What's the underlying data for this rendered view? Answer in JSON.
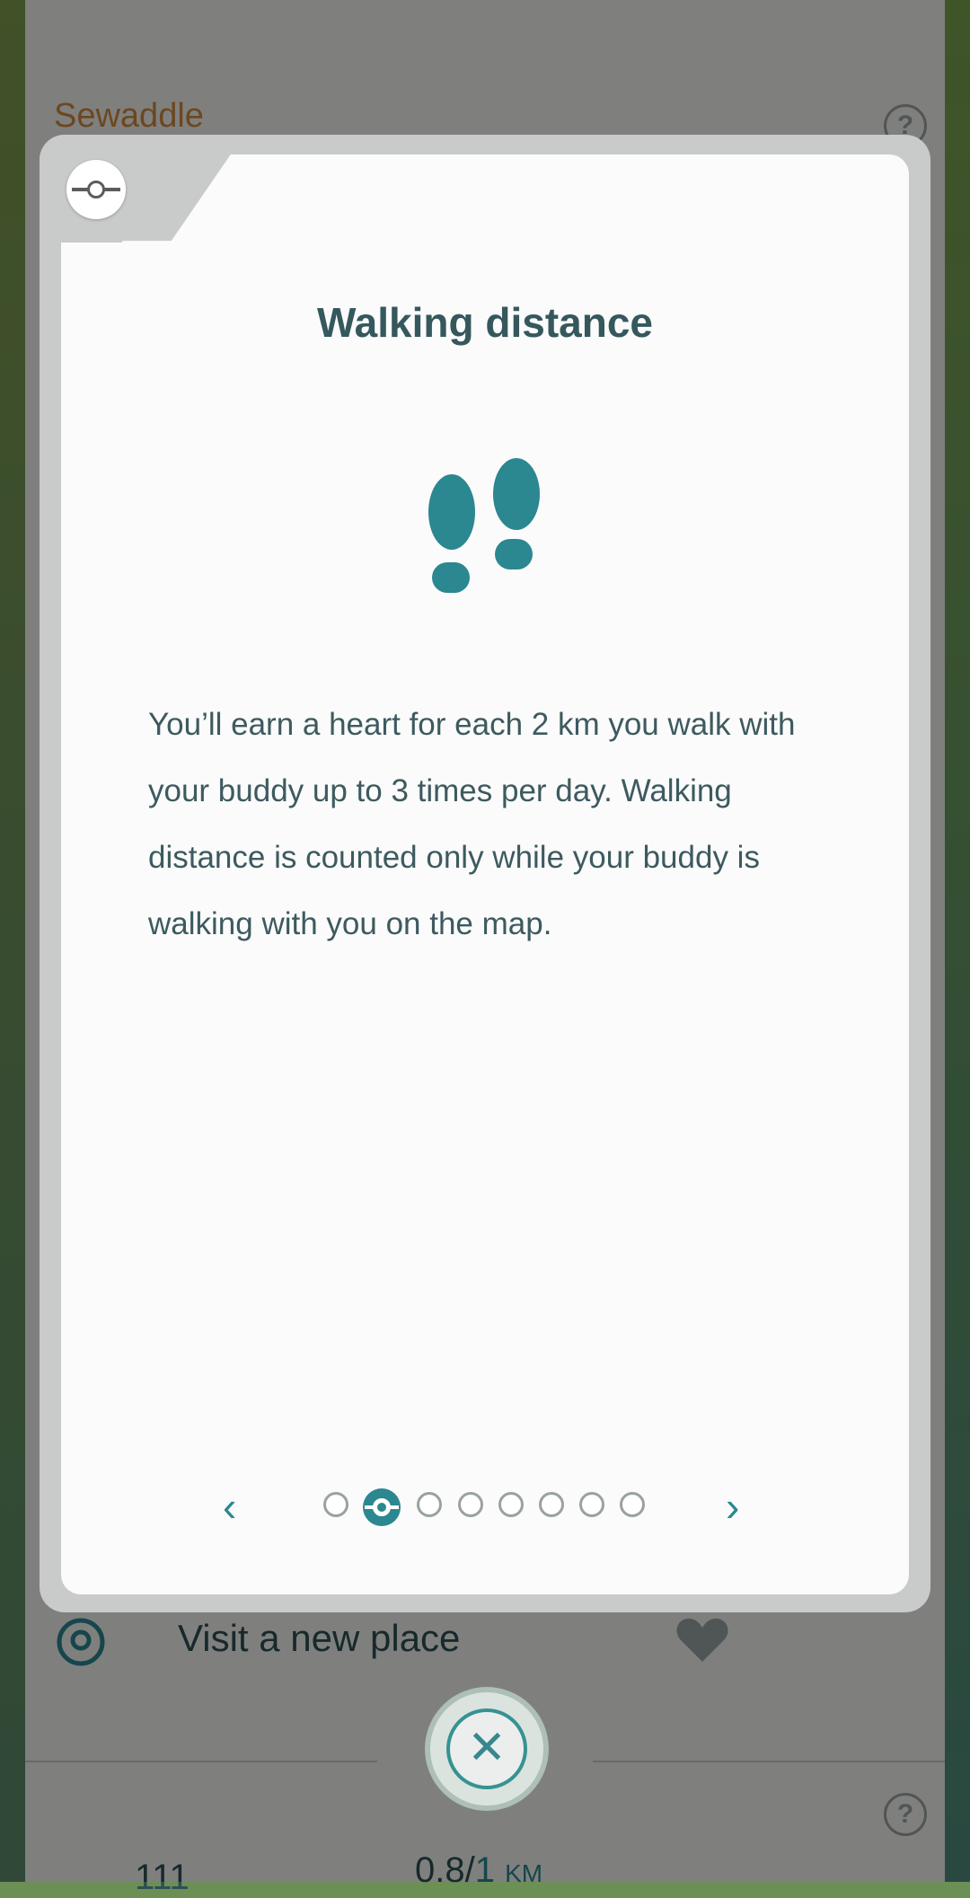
{
  "background": {
    "title": "Sewaddle",
    "rows": [
      "Visit a new place"
    ],
    "bottom_left_value": "111",
    "bottom_distance": "0.8/",
    "bottom_distance_goal": "1",
    "bottom_distance_unit": "KM"
  },
  "modal": {
    "title": "Walking distance",
    "body": "You’ll earn a heart for each 2 km you walk with your buddy up to 3 times per day. Walking distance is counted only while your buddy is walking with you on the map.",
    "icon": "footsteps-icon",
    "pager": {
      "prev_label": "‹",
      "next_label": "›",
      "total_pages": 8,
      "active_page": 2
    }
  },
  "colors": {
    "accent": "#2b8790",
    "title": "#35585d",
    "text": "#3d5a5f"
  }
}
